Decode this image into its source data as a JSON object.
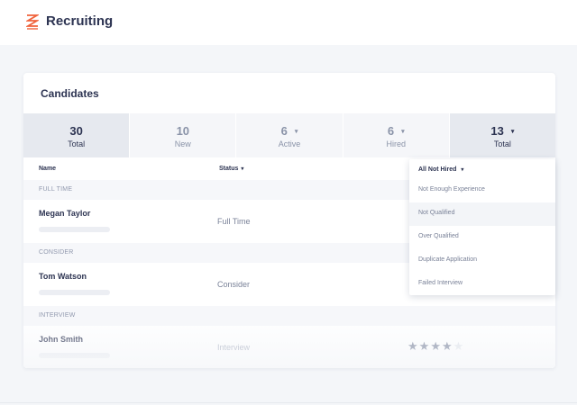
{
  "app": {
    "title": "Recruiting",
    "logo": "zigzag-logo-icon"
  },
  "colors": {
    "accent": "#f0633c",
    "text": "#2d3452",
    "muted": "#8a93a8",
    "star": "#7b849c"
  },
  "card": {
    "title": "Candidates"
  },
  "stats": [
    {
      "value": "30",
      "label": "Total",
      "caret": ""
    },
    {
      "value": "10",
      "label": "New",
      "caret": ""
    },
    {
      "value": "6",
      "label": "Active",
      "caret": "▾"
    },
    {
      "value": "6",
      "label": "Hired",
      "caret": "▾"
    },
    {
      "value": "13",
      "label": "Total",
      "caret": "▾"
    }
  ],
  "table": {
    "columns": {
      "name": "Name",
      "status": "Status",
      "status_caret": "▾"
    },
    "sections": [
      {
        "label": "FULL TIME",
        "candidate": {
          "name": "Megan Taylor",
          "status": "Full Time"
        }
      },
      {
        "label": "CONSIDER",
        "candidate": {
          "name": "Tom Watson",
          "status": "Consider"
        }
      },
      {
        "label": "INTERVIEW",
        "candidate": {
          "name": "John Smith",
          "status": "Interview",
          "rating": 4,
          "rating_max": 5
        }
      }
    ]
  },
  "dropdown": {
    "selected": "All Not Hired",
    "caret": "▾",
    "options": [
      "Not Enough Experience",
      "Not Qualified",
      "Over Qualified",
      "Duplicate Application",
      "Failed Interview"
    ]
  }
}
